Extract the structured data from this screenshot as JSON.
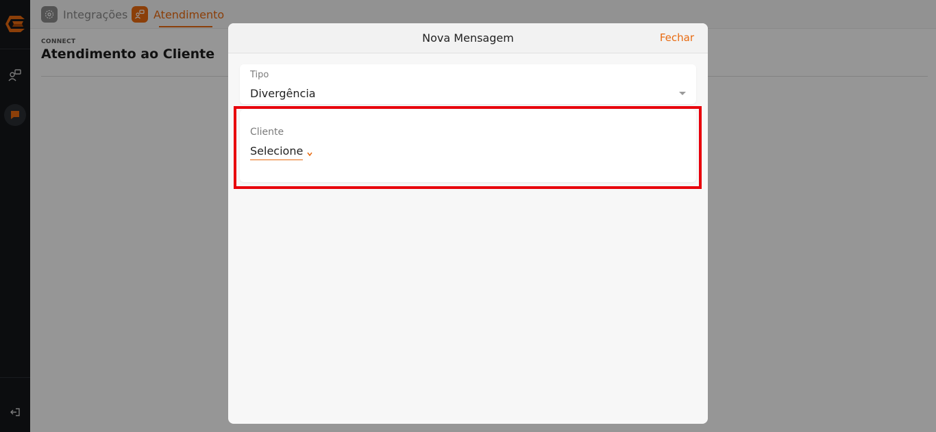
{
  "colors": {
    "accent": "#e86a10",
    "sidebar_bg": "#14161a",
    "highlight": "#e8000b"
  },
  "sidebar": {
    "logo_icon": "brand-logo-icon",
    "items": [
      {
        "icon": "users-chat-icon"
      },
      {
        "icon": "chat-bubble-icon",
        "active": true
      }
    ],
    "logout_icon": "logout-icon"
  },
  "topbar": {
    "tabs": [
      {
        "label": "Integrações",
        "icon": "integration-icon",
        "active": false
      },
      {
        "label": "Atendimento",
        "icon": "support-icon",
        "active": true
      }
    ]
  },
  "page": {
    "breadcrumb": "CONNECT",
    "title": "Atendimento ao Cliente"
  },
  "modal": {
    "title": "Nova Mensagem",
    "close_label": "Fechar",
    "tipo": {
      "label": "Tipo",
      "value": "Divergência"
    },
    "cliente": {
      "label": "Cliente",
      "value": "Selecione"
    }
  }
}
